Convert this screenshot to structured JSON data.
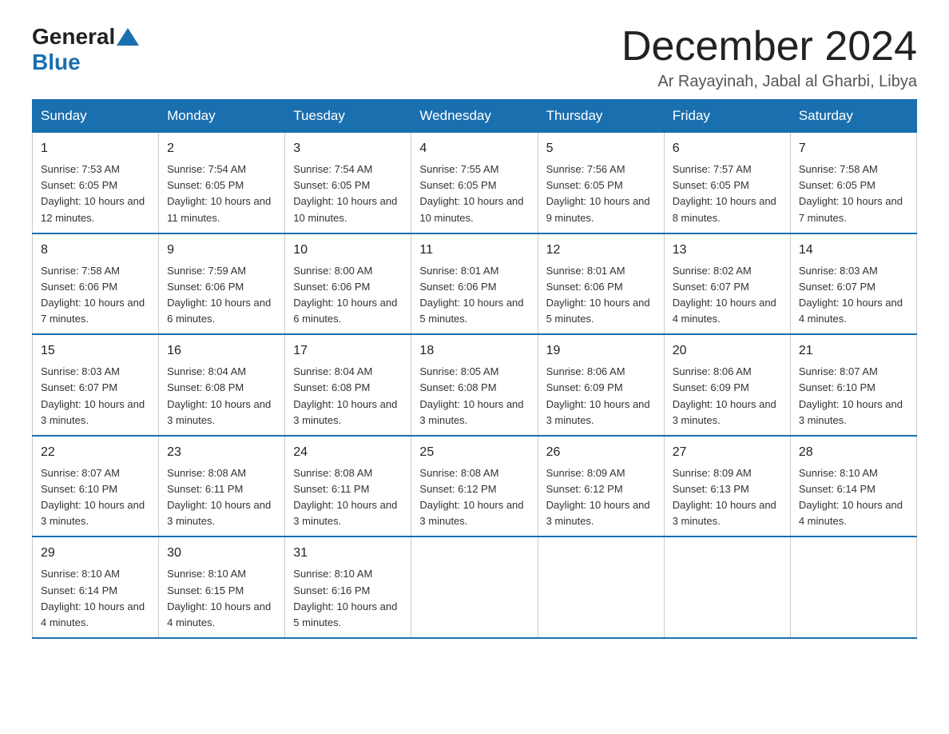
{
  "header": {
    "logo_general": "General",
    "logo_blue": "Blue",
    "month_title": "December 2024",
    "subtitle": "Ar Rayayinah, Jabal al Gharbi, Libya"
  },
  "calendar": {
    "days_of_week": [
      "Sunday",
      "Monday",
      "Tuesday",
      "Wednesday",
      "Thursday",
      "Friday",
      "Saturday"
    ],
    "weeks": [
      [
        {
          "day": "1",
          "sunrise": "7:53 AM",
          "sunset": "6:05 PM",
          "daylight": "10 hours and 12 minutes."
        },
        {
          "day": "2",
          "sunrise": "7:54 AM",
          "sunset": "6:05 PM",
          "daylight": "10 hours and 11 minutes."
        },
        {
          "day": "3",
          "sunrise": "7:54 AM",
          "sunset": "6:05 PM",
          "daylight": "10 hours and 10 minutes."
        },
        {
          "day": "4",
          "sunrise": "7:55 AM",
          "sunset": "6:05 PM",
          "daylight": "10 hours and 10 minutes."
        },
        {
          "day": "5",
          "sunrise": "7:56 AM",
          "sunset": "6:05 PM",
          "daylight": "10 hours and 9 minutes."
        },
        {
          "day": "6",
          "sunrise": "7:57 AM",
          "sunset": "6:05 PM",
          "daylight": "10 hours and 8 minutes."
        },
        {
          "day": "7",
          "sunrise": "7:58 AM",
          "sunset": "6:05 PM",
          "daylight": "10 hours and 7 minutes."
        }
      ],
      [
        {
          "day": "8",
          "sunrise": "7:58 AM",
          "sunset": "6:06 PM",
          "daylight": "10 hours and 7 minutes."
        },
        {
          "day": "9",
          "sunrise": "7:59 AM",
          "sunset": "6:06 PM",
          "daylight": "10 hours and 6 minutes."
        },
        {
          "day": "10",
          "sunrise": "8:00 AM",
          "sunset": "6:06 PM",
          "daylight": "10 hours and 6 minutes."
        },
        {
          "day": "11",
          "sunrise": "8:01 AM",
          "sunset": "6:06 PM",
          "daylight": "10 hours and 5 minutes."
        },
        {
          "day": "12",
          "sunrise": "8:01 AM",
          "sunset": "6:06 PM",
          "daylight": "10 hours and 5 minutes."
        },
        {
          "day": "13",
          "sunrise": "8:02 AM",
          "sunset": "6:07 PM",
          "daylight": "10 hours and 4 minutes."
        },
        {
          "day": "14",
          "sunrise": "8:03 AM",
          "sunset": "6:07 PM",
          "daylight": "10 hours and 4 minutes."
        }
      ],
      [
        {
          "day": "15",
          "sunrise": "8:03 AM",
          "sunset": "6:07 PM",
          "daylight": "10 hours and 3 minutes."
        },
        {
          "day": "16",
          "sunrise": "8:04 AM",
          "sunset": "6:08 PM",
          "daylight": "10 hours and 3 minutes."
        },
        {
          "day": "17",
          "sunrise": "8:04 AM",
          "sunset": "6:08 PM",
          "daylight": "10 hours and 3 minutes."
        },
        {
          "day": "18",
          "sunrise": "8:05 AM",
          "sunset": "6:08 PM",
          "daylight": "10 hours and 3 minutes."
        },
        {
          "day": "19",
          "sunrise": "8:06 AM",
          "sunset": "6:09 PM",
          "daylight": "10 hours and 3 minutes."
        },
        {
          "day": "20",
          "sunrise": "8:06 AM",
          "sunset": "6:09 PM",
          "daylight": "10 hours and 3 minutes."
        },
        {
          "day": "21",
          "sunrise": "8:07 AM",
          "sunset": "6:10 PM",
          "daylight": "10 hours and 3 minutes."
        }
      ],
      [
        {
          "day": "22",
          "sunrise": "8:07 AM",
          "sunset": "6:10 PM",
          "daylight": "10 hours and 3 minutes."
        },
        {
          "day": "23",
          "sunrise": "8:08 AM",
          "sunset": "6:11 PM",
          "daylight": "10 hours and 3 minutes."
        },
        {
          "day": "24",
          "sunrise": "8:08 AM",
          "sunset": "6:11 PM",
          "daylight": "10 hours and 3 minutes."
        },
        {
          "day": "25",
          "sunrise": "8:08 AM",
          "sunset": "6:12 PM",
          "daylight": "10 hours and 3 minutes."
        },
        {
          "day": "26",
          "sunrise": "8:09 AM",
          "sunset": "6:12 PM",
          "daylight": "10 hours and 3 minutes."
        },
        {
          "day": "27",
          "sunrise": "8:09 AM",
          "sunset": "6:13 PM",
          "daylight": "10 hours and 3 minutes."
        },
        {
          "day": "28",
          "sunrise": "8:10 AM",
          "sunset": "6:14 PM",
          "daylight": "10 hours and 4 minutes."
        }
      ],
      [
        {
          "day": "29",
          "sunrise": "8:10 AM",
          "sunset": "6:14 PM",
          "daylight": "10 hours and 4 minutes."
        },
        {
          "day": "30",
          "sunrise": "8:10 AM",
          "sunset": "6:15 PM",
          "daylight": "10 hours and 4 minutes."
        },
        {
          "day": "31",
          "sunrise": "8:10 AM",
          "sunset": "6:16 PM",
          "daylight": "10 hours and 5 minutes."
        },
        null,
        null,
        null,
        null
      ]
    ]
  }
}
